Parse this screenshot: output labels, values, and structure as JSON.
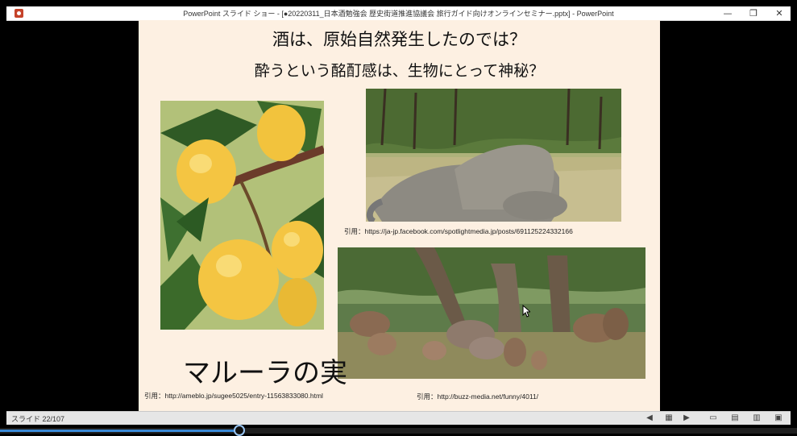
{
  "window": {
    "title": "PowerPoint スライド ショー - [●20220311_日本酒勉強会 歴史街道推進協議会 旅行ガイド向けオンラインセミナー.pptx] - PowerPoint",
    "controls": {
      "minimize": "—",
      "maximize": "❐",
      "close": "✕"
    }
  },
  "slide": {
    "heading1": "酒は、原始自然発生したのでは？",
    "heading2": "酔うという酩酊感は、生物にとって神秘？",
    "marula_label": "マルーラの実",
    "captions": {
      "elephant": "引用：https://ja-jp.facebook.com/spotlightmedia.jp/posts/691125224332166",
      "marula": "引用：http://ameblo.jp/sugee5025/entry-11563833080.html",
      "baboon": "引用：http://buzz-media.net/funny/4011/"
    },
    "images": {
      "marula": "marula-fruit-photo",
      "elephant": "drunk-elephants-photo",
      "baboon": "baboons-under-tree-photo"
    }
  },
  "statusbar": {
    "slide_counter": "スライド 22/107",
    "progress_fraction": 0.3
  },
  "colors": {
    "slide_background": "#fdf0e2",
    "progress": "#3a8ad8"
  }
}
